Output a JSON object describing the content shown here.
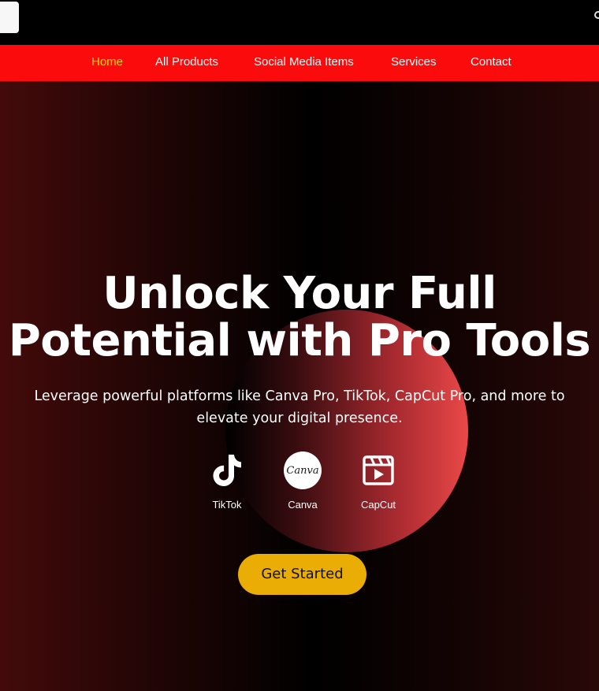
{
  "nav": {
    "items": [
      {
        "label": "Home",
        "active": true
      },
      {
        "label": "All Products",
        "active": false
      },
      {
        "label": "Social Media Items",
        "active": false
      },
      {
        "label": "Services",
        "active": false
      },
      {
        "label": "Contact",
        "active": false
      }
    ]
  },
  "hero": {
    "title_line1": "Unlock Your Full",
    "title_line2": "Potential with Pro Tools",
    "subtitle_line1": "Leverage powerful platforms like Canva Pro, TikTok, CapCut Pro, and more to",
    "subtitle_line2": "elevate your digital presence.",
    "platforms": [
      {
        "label": "TikTok",
        "icon": "tiktok-icon"
      },
      {
        "label": "Canva",
        "icon": "canva-icon",
        "logo_text": "Canva"
      },
      {
        "label": "CapCut",
        "icon": "capcut-icon"
      }
    ],
    "cta_label": "Get Started"
  },
  "colors": {
    "nav_bg": "#fb0b0b",
    "nav_active": "#ffd400",
    "cta_bg": "#e9ad06",
    "orb_accent": "#ea4848"
  }
}
